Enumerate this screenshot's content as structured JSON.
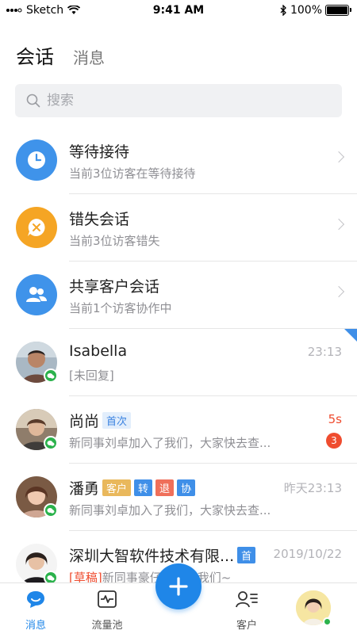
{
  "status_bar": {
    "carrier": "Sketch",
    "time": "9:41 AM",
    "battery": "100%"
  },
  "header": {
    "tabs": [
      {
        "label": "会话"
      },
      {
        "label": "消息"
      }
    ]
  },
  "search": {
    "placeholder": "搜索"
  },
  "system_rows": [
    {
      "title": "等待接待",
      "subtitle": "当前3位访客在等待接待",
      "icon": "clock-icon",
      "color": "#3f93ea"
    },
    {
      "title": "错失会话",
      "subtitle": "当前3位访客错失",
      "icon": "missed-chat-icon",
      "color": "#f5a524"
    },
    {
      "title": "共享客户会话",
      "subtitle": "当前1个访客协作中",
      "icon": "people-icon",
      "color": "#3f93ea"
    }
  ],
  "conversations": [
    {
      "name": "Isabella",
      "message": "[未回复]",
      "time": "23:13"
    },
    {
      "name": "尚尚",
      "tag": "首次",
      "message": "新同事刘卓加入了我们，大家快去查...",
      "time": "5s",
      "unread": "3"
    },
    {
      "name": "潘勇",
      "tags": [
        "客户",
        "转",
        "退",
        "协"
      ],
      "message": "新同事刘卓加入了我们，大家快去查...",
      "time": "昨天23:13"
    },
    {
      "name": "深圳大智软件技术有限...",
      "tag": "首",
      "draft": "[草稿]",
      "message": "新同事豪仔加入了我们~",
      "time": "2019/10/22"
    }
  ],
  "bottom_nav": {
    "messages": "消息",
    "traffic_pool": "流量池",
    "customers": "客户"
  },
  "colors": {
    "accent": "#1f86e8",
    "wechat": "#2bb24c",
    "alert": "#ef4c2f"
  }
}
